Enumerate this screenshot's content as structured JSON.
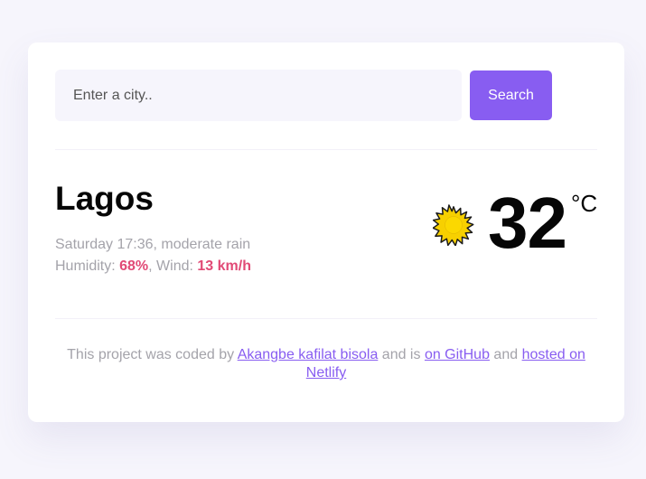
{
  "search": {
    "placeholder": "Enter a city..",
    "button_label": "Search"
  },
  "weather": {
    "city": "Lagos",
    "date_time": "Saturday 17:36",
    "separator": ", ",
    "description": "moderate rain",
    "humidity_label": "Humidity: ",
    "humidity_value": "68%",
    "wind_label": ", Wind: ",
    "wind_value": "13 km/h",
    "icon": "sun-icon",
    "temperature": "32",
    "unit": "°C"
  },
  "footer": {
    "text_1": "This project was coded by ",
    "author_link": "Akangbe kafilat bisola",
    "text_2": " and is ",
    "github_link": "on GitHub",
    "text_3": " and ",
    "netlify_link": "hosted on Netlify"
  },
  "colors": {
    "accent": "#885df1",
    "highlight": "#e14a76",
    "background": "#f6f5fc",
    "sun": "#f7d000"
  }
}
